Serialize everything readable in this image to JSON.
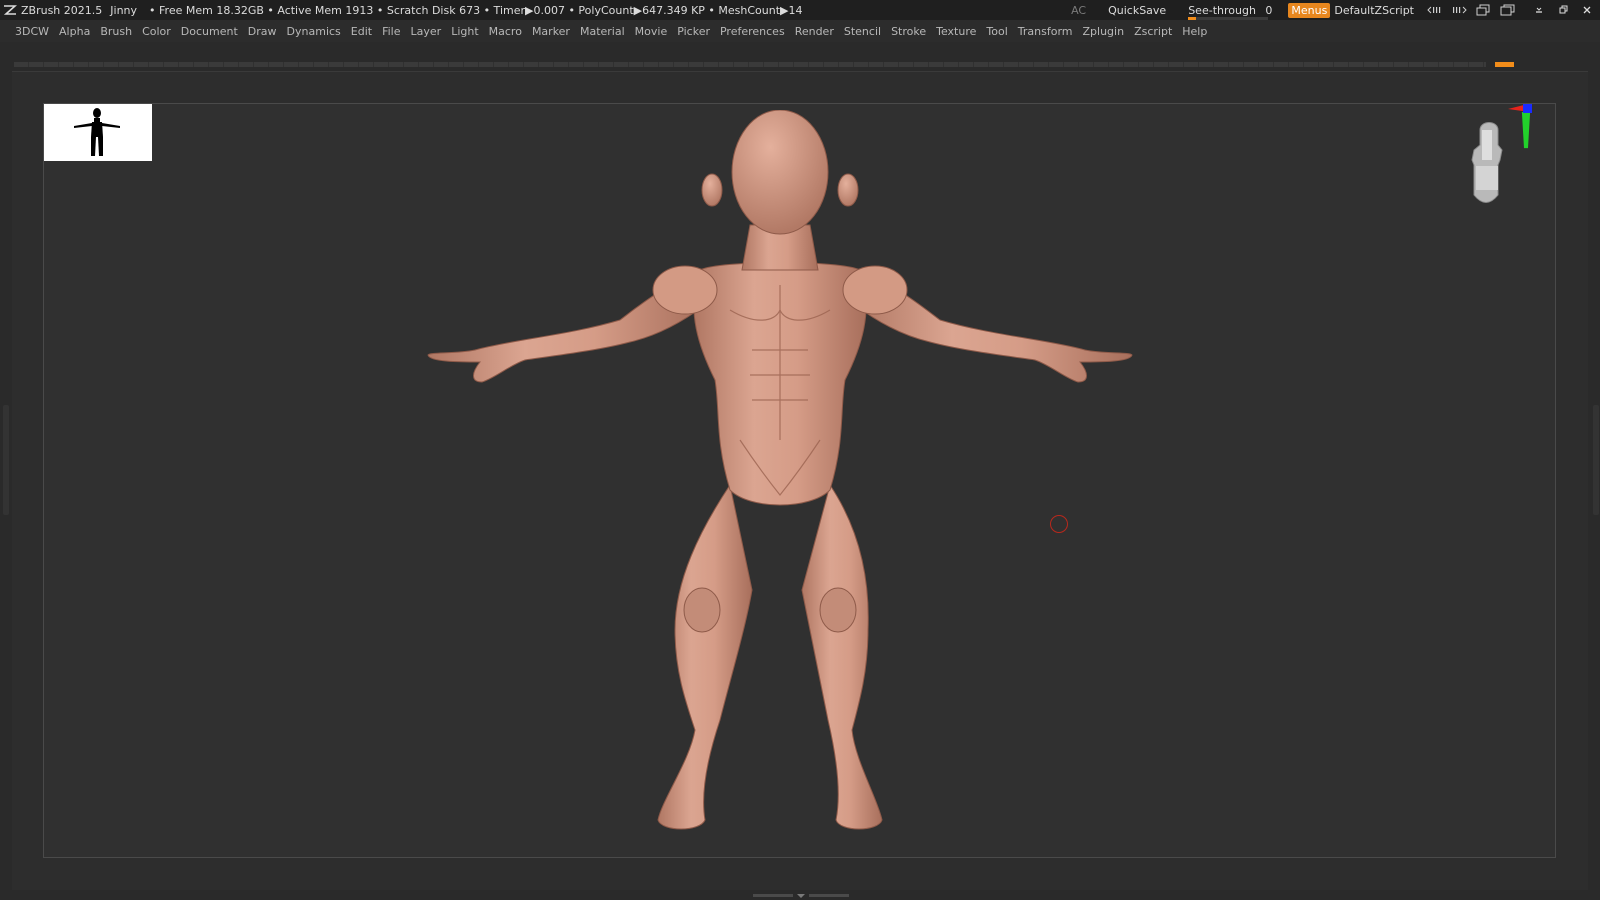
{
  "titlebar": {
    "app": "ZBrush 2021.5",
    "project": "Jinny",
    "stats": "• Free Mem 18.32GB • Active Mem 1913 • Scratch Disk 673 •  Timer▶0.007 • PolyCount▶647.349 KP  • MeshCount▶14",
    "ac": "AC",
    "quicksave": "QuickSave",
    "seethrough_label": "See-through",
    "seethrough_value": "0",
    "seethrough_fraction": 0.1,
    "menus": "Menus",
    "script": "DefaultZScript"
  },
  "menu": [
    "3DCW",
    "Alpha",
    "Brush",
    "Color",
    "Document",
    "Draw",
    "Dynamics",
    "Edit",
    "File",
    "Layer",
    "Light",
    "Macro",
    "Marker",
    "Material",
    "Movie",
    "Picker",
    "Preferences",
    "Render",
    "Stencil",
    "Stroke",
    "Texture",
    "Tool",
    "Transform",
    "Zplugin",
    "Zscript",
    "Help"
  ],
  "colors": {
    "accent": "#e8871e",
    "skin": "#d39a84",
    "axis_x": "#e8231c",
    "axis_y": "#22d12b",
    "axis_z": "#1a2bff"
  }
}
